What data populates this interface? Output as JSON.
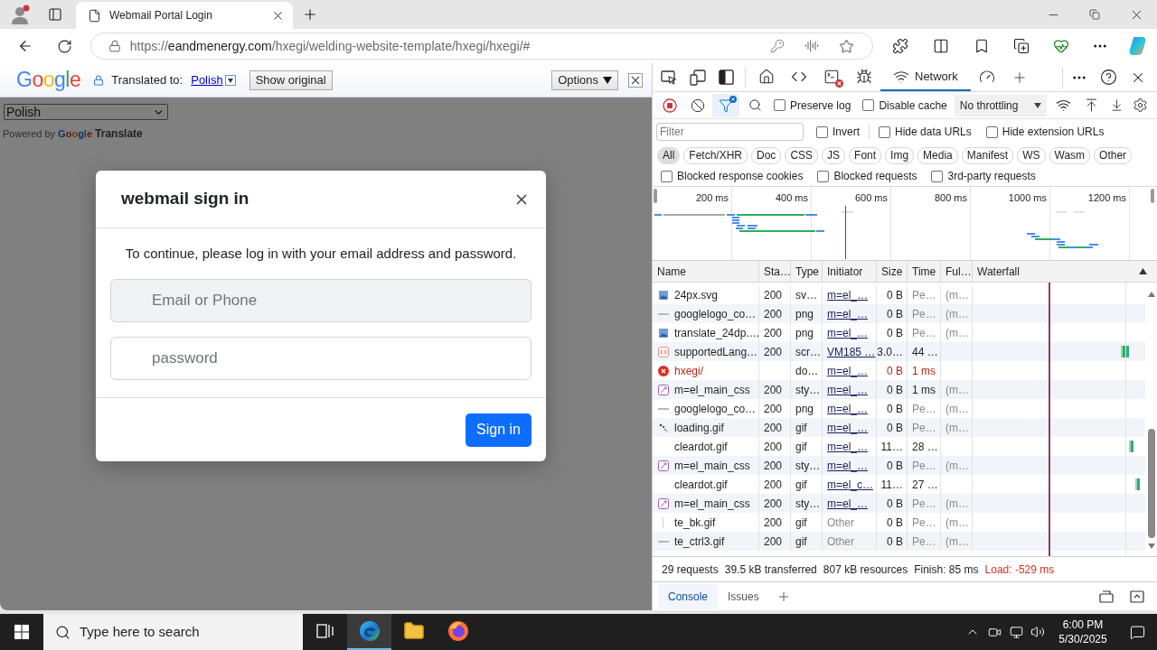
{
  "browser": {
    "tabs": [
      {
        "title": "Webmail Portal Login",
        "selected": true
      }
    ],
    "url": {
      "scheme": "https://",
      "host": "eandmenergy.com",
      "path": "/hxegi/welding-website-template/hxegi/hxegi/#"
    }
  },
  "translate_bar": {
    "logo": "Google",
    "label": "Translated to:",
    "language": "Polish",
    "show_original": "Show original",
    "options": "Options"
  },
  "page": {
    "language_select": "Polish",
    "powered_by": "Powered by",
    "brand": "Google",
    "product": "Translate"
  },
  "modal": {
    "title": "webmail sign in",
    "message": "To continue, please log in with your email address and password.",
    "fields": [
      {
        "placeholder": "Email or Phone",
        "focused": true
      },
      {
        "placeholder": "password",
        "focused": false
      }
    ],
    "submit": "Sign in"
  },
  "devtools": {
    "panel_tabs": [
      {
        "kind": "welcome",
        "selected": false
      },
      {
        "kind": "elements",
        "selected": false
      },
      {
        "kind": "console",
        "selected": false,
        "errors": true
      },
      {
        "kind": "sources",
        "selected": false
      },
      {
        "kind": "network",
        "label": "Network",
        "selected": true
      },
      {
        "kind": "performance",
        "selected": false
      }
    ],
    "toolbar": {
      "recording": true,
      "filter_active": true,
      "options": [
        {
          "label": "Preserve log",
          "checked": false
        },
        {
          "label": "Disable cache",
          "checked": false
        }
      ],
      "throttling": "No throttling"
    },
    "filter": {
      "placeholder": "Filter",
      "options": [
        {
          "label": "Invert",
          "checked": false
        },
        {
          "label": "Hide data URLs",
          "checked": false
        },
        {
          "label": "Hide extension URLs",
          "checked": false
        }
      ]
    },
    "type_filters": [
      {
        "label": "All",
        "selected": true
      },
      {
        "label": "Fetch/XHR",
        "selected": false
      },
      {
        "label": "Doc",
        "selected": false
      },
      {
        "label": "CSS",
        "selected": false
      },
      {
        "label": "JS",
        "selected": false
      },
      {
        "label": "Font",
        "selected": false
      },
      {
        "label": "Img",
        "selected": false
      },
      {
        "label": "Media",
        "selected": false
      },
      {
        "label": "Manifest",
        "selected": false
      },
      {
        "label": "WS",
        "selected": false
      },
      {
        "label": "Wasm",
        "selected": false
      },
      {
        "label": "Other",
        "selected": false
      }
    ],
    "blocked_options": [
      {
        "label": "Blocked response cookies",
        "checked": false
      },
      {
        "label": "Blocked requests",
        "checked": false
      },
      {
        "label": "3rd-party requests",
        "checked": false
      }
    ],
    "overview": {
      "ticks": [
        "200 ms",
        "400 ms",
        "600 ms",
        "800 ms",
        "1000 ms",
        "1200 ms"
      ]
    },
    "columns": [
      "Name",
      "Sta…",
      "Type",
      "Initiator",
      "Size",
      "Time",
      "Ful…",
      "Waterfall"
    ],
    "rows": [
      {
        "kind": "image",
        "name": "24px.svg",
        "status": "200",
        "type": "sv…",
        "initiator": "m=el_…",
        "initiator_link": true,
        "size": "0 B",
        "time": "Pe…",
        "pending": true,
        "fulfilled": "(m…",
        "error": false
      },
      {
        "kind": "dash",
        "name": "googlelogo_co…",
        "status": "200",
        "type": "png",
        "initiator": "m=el_…",
        "initiator_link": true,
        "size": "0 B",
        "time": "Pe…",
        "pending": true,
        "fulfilled": "(m…",
        "error": false
      },
      {
        "kind": "image",
        "name": "translate_24dp.…",
        "status": "200",
        "type": "png",
        "initiator": "m=el_…",
        "initiator_link": true,
        "size": "0 B",
        "time": "Pe…",
        "pending": true,
        "fulfilled": "(m…",
        "error": false
      },
      {
        "kind": "script",
        "name": "supportedLang…",
        "status": "200",
        "type": "scr…",
        "initiator": "VM185 …",
        "initiator_link": true,
        "size": "3.0…",
        "time": "44 …",
        "pending": false,
        "error": false
      },
      {
        "kind": "error",
        "name": "hxegi/",
        "type": "do…",
        "initiator": "m=el_…",
        "initiator_link": true,
        "size": "0 B",
        "time": "1 ms",
        "pending": false,
        "error": true
      },
      {
        "kind": "stylesheet",
        "name": "m=el_main_css",
        "status": "200",
        "type": "sty…",
        "initiator": "m=el_…",
        "initiator_link": true,
        "size": "0 B",
        "time": "1 ms",
        "pending": false,
        "fulfilled": "(m…",
        "error": false
      },
      {
        "kind": "dash",
        "name": "googlelogo_co…",
        "status": "200",
        "type": "png",
        "initiator": "m=el_…",
        "initiator_link": true,
        "size": "0 B",
        "time": "Pe…",
        "pending": true,
        "fulfilled": "(m…",
        "error": false
      },
      {
        "kind": "spinner",
        "name": "loading.gif",
        "status": "200",
        "type": "gif",
        "initiator": "m=el_…",
        "initiator_link": true,
        "size": "0 B",
        "time": "Pe…",
        "pending": true,
        "fulfilled": "(m…",
        "error": false
      },
      {
        "kind": "plain",
        "name": "cleardot.gif",
        "status": "200",
        "type": "gif",
        "initiator": "m=el_…",
        "initiator_link": true,
        "size": "11…",
        "time": "28 …",
        "pending": false,
        "error": false
      },
      {
        "kind": "stylesheet",
        "name": "m=el_main_css",
        "status": "200",
        "type": "sty…",
        "initiator": "m=el_…",
        "initiator_link": true,
        "size": "0 B",
        "time": "Pe…",
        "pending": true,
        "fulfilled": "(m…",
        "error": false
      },
      {
        "kind": "plain",
        "name": "cleardot.gif",
        "status": "200",
        "type": "gif",
        "initiator": "m=el_c…",
        "initiator_link": true,
        "size": "11…",
        "time": "27 …",
        "pending": false,
        "error": false
      },
      {
        "kind": "stylesheet",
        "name": "m=el_main_css",
        "status": "200",
        "type": "sty…",
        "initiator": "m=el_…",
        "initiator_link": true,
        "size": "0 B",
        "time": "Pe…",
        "pending": true,
        "fulfilled": "(m…",
        "error": false
      },
      {
        "kind": "line",
        "name": "te_bk.gif",
        "status": "200",
        "type": "gif",
        "initiator": "Other",
        "initiator_link": false,
        "size": "0 B",
        "time": "Pe…",
        "pending": true,
        "fulfilled": "(m…",
        "error": false
      },
      {
        "kind": "dash",
        "name": "te_ctrl3.gif",
        "status": "200",
        "type": "gif",
        "initiator": "Other",
        "initiator_link": false,
        "size": "0 B",
        "time": "Pe…",
        "pending": true,
        "fulfilled": "(m…",
        "error": false
      }
    ],
    "summary": [
      {
        "text": "29 requests",
        "kind": "stat"
      },
      {
        "text": "39.5 kB transferred",
        "kind": "stat"
      },
      {
        "text": "807 kB resources",
        "kind": "stat"
      },
      {
        "text": "Finish: 85 ms",
        "kind": "stat"
      },
      {
        "text": "Load: -529 ms",
        "kind": "load"
      }
    ],
    "drawer_tabs": [
      {
        "label": "Console",
        "selected": true
      },
      {
        "label": "Issues",
        "selected": false
      }
    ]
  },
  "taskbar": {
    "search_placeholder": "Type here to search",
    "apps": [
      {
        "kind": "task-view",
        "active": false
      },
      {
        "kind": "edge",
        "active": true
      },
      {
        "kind": "explorer",
        "active": false
      },
      {
        "kind": "firefox",
        "active": false
      }
    ],
    "time": "6:00 PM",
    "date": "5/30/2025"
  }
}
